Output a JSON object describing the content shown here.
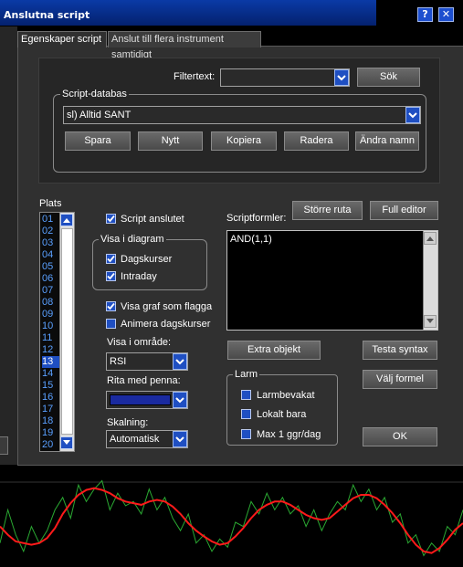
{
  "window": {
    "title": "Anslutna script"
  },
  "tabs": [
    {
      "label": "Egenskaper script",
      "active": true
    },
    {
      "label": "Anslut till flera instrument samtidigt",
      "active": false
    }
  ],
  "filter": {
    "label": "Filtertext:",
    "value": "",
    "search_label": "Sök"
  },
  "script_db": {
    "title": "Script-databas",
    "selected": "sl) Alltid SANT",
    "buttons": [
      "Spara",
      "Nytt",
      "Kopiera",
      "Radera",
      "Ändra namn"
    ]
  },
  "plats": {
    "label": "Plats",
    "items": [
      "01",
      "02",
      "03",
      "04",
      "05",
      "06",
      "07",
      "08",
      "09",
      "10",
      "11",
      "12",
      "13",
      "14",
      "15",
      "16",
      "17",
      "18",
      "19",
      "20"
    ],
    "selected": "13"
  },
  "options": {
    "script_anslutet": {
      "label": "Script anslutet",
      "checked": true
    },
    "visa_i_diagram": {
      "title": "Visa i diagram",
      "dagskurser": {
        "label": "Dagskurser",
        "checked": true
      },
      "intraday": {
        "label": "Intraday",
        "checked": true
      }
    },
    "visa_graf": {
      "label": "Visa graf som flagga",
      "checked": true
    },
    "animera": {
      "label": "Animera dagskurser",
      "checked": false
    },
    "visa_i_omrade": {
      "label": "Visa i område:",
      "value": "RSI"
    },
    "rita_med_penna": {
      "label": "Rita med penna:",
      "pen_color": "#1a2aa0"
    },
    "skalning": {
      "label": "Skalning:",
      "value": "Automatisk"
    }
  },
  "script": {
    "label": "Scriptformler:",
    "larger_button": "Större ruta",
    "full_editor_button": "Full editor",
    "formula": "AND(1,1)",
    "extra_button": "Extra objekt",
    "test_button": "Testa syntax",
    "choose_button": "Välj formel"
  },
  "alarm": {
    "title": "Larm",
    "items": [
      {
        "label": "Larmbevakat",
        "checked": false
      },
      {
        "label": "Lokalt bara",
        "checked": false
      },
      {
        "label": "Max 1 ggr/dag",
        "checked": false
      }
    ]
  },
  "ok_label": "OK",
  "colors": {
    "accent": "#1f4fc2",
    "titlebar": "#0a3aa6",
    "line_red": "#ff1a1a",
    "line_green": "#2aa832"
  },
  "chart_data": {
    "type": "line",
    "series": [
      {
        "values": [
          40,
          30,
          22,
          20,
          18,
          20,
          26,
          38,
          55,
          68,
          78,
          84,
          86,
          84,
          80,
          74,
          70,
          68,
          66,
          70,
          72,
          70,
          64,
          55,
          44,
          35,
          28,
          22,
          18,
          20,
          28,
          38,
          50,
          60,
          66,
          70,
          70,
          66,
          60,
          54,
          50,
          48,
          50,
          58,
          66,
          74,
          78,
          78,
          74,
          66,
          56,
          44,
          30,
          18,
          10,
          8,
          14,
          24,
          36,
          44
        ]
      },
      {
        "values": [
          20,
          60,
          30,
          10,
          40,
          20,
          35,
          60,
          75,
          50,
          90,
          70,
          85,
          95,
          60,
          80,
          65,
          70,
          55,
          85,
          60,
          75,
          50,
          35,
          55,
          20,
          30,
          10,
          25,
          15,
          45,
          40,
          70,
          55,
          80,
          60,
          75,
          55,
          65,
          40,
          60,
          35,
          55,
          70,
          60,
          90,
          70,
          85,
          60,
          75,
          45,
          55,
          20,
          30,
          5,
          20,
          10,
          40,
          30,
          60
        ]
      }
    ]
  }
}
